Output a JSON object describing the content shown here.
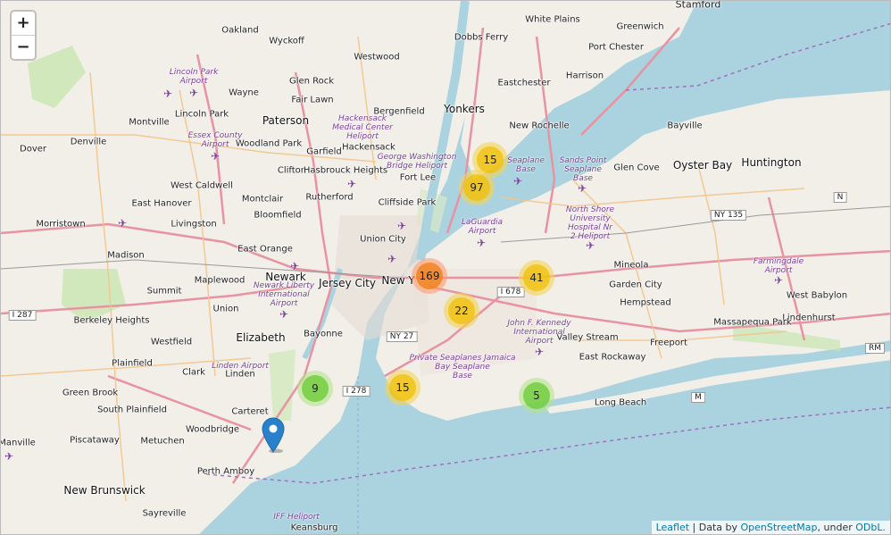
{
  "zoom": {
    "in_label": "+",
    "out_label": "−"
  },
  "clusters": [
    {
      "count": "15",
      "size": "medium"
    },
    {
      "count": "97",
      "size": "medium"
    },
    {
      "count": "169",
      "size": "large"
    },
    {
      "count": "41",
      "size": "medium"
    },
    {
      "count": "22",
      "size": "medium"
    },
    {
      "count": "9",
      "size": "small"
    },
    {
      "count": "15",
      "size": "medium"
    },
    {
      "count": "5",
      "size": "small"
    }
  ],
  "places": {
    "stamford": "Stamford",
    "oakland": "Oakland",
    "wyckoff": "Wyckoff",
    "dobbs_ferry": "Dobbs Ferry",
    "white_plains": "White Plains",
    "greenwich": "Greenwich",
    "westwood": "Westwood",
    "port_chester": "Port Chester",
    "glen_rock": "Glen Rock",
    "wayne": "Wayne",
    "fair_lawn": "Fair Lawn",
    "eastchester": "Eastchester",
    "harrison": "Harrison",
    "yonkers": "Yonkers",
    "bergenfield": "Bergenfield",
    "montville": "Montville",
    "lincoln_park": "Lincoln Park",
    "paterson": "Paterson",
    "new_rochelle": "New Rochelle",
    "bayville": "Bayville",
    "dover": "Dover",
    "denville": "Denville",
    "woodland_park": "Woodland Park",
    "garfield": "Garfield",
    "hackensack": "Hackensack",
    "clifton": "Clifton",
    "hasbrouck_heights": "Hasbrouck Heights",
    "oyster_bay": "Oyster Bay",
    "huntington": "Huntington",
    "glen_cove": "Glen Cove",
    "fort_lee": "Fort Lee",
    "west_caldwell": "West Caldwell",
    "rutherford": "Rutherford",
    "montclair": "Montclair",
    "cliffside_park": "Cliffside Park",
    "east_hanover": "East Hanover",
    "morristown": "Morristown",
    "livingston": "Livingston",
    "bloomfield": "Bloomfield",
    "union_city": "Union City",
    "east_orange": "East Orange",
    "madison": "Madison",
    "mineola": "Mineola",
    "newark": "Newark",
    "maplewood": "Maplewood",
    "jersey_city": "Jersey City",
    "new_york": "New Y",
    "garden_city": "Garden City",
    "summit": "Summit",
    "hempstead": "Hempstead",
    "west_babylon": "West Babylon",
    "union": "Union",
    "berkeley_heights": "Berkeley Heights",
    "bayonne": "Bayonne",
    "lindenhurst": "Lindenhurst",
    "massapequa_park": "Massapequa Park",
    "elizabeth": "Elizabeth",
    "westfield": "Westfield",
    "valley_stream": "Valley Stream",
    "freeport": "Freeport",
    "east_rockaway": "East Rockaway",
    "plainfield": "Plainfield",
    "clark": "Clark",
    "linden": "Linden",
    "green_brook": "Green Brook",
    "long_beach": "Long Beach",
    "south_plainfield": "South Plainfield",
    "carteret": "Carteret",
    "woodbridge": "Woodbridge",
    "manville": "Manville",
    "piscataway": "Piscataway",
    "metuchen": "Metuchen",
    "perth_amboy": "Perth Amboy",
    "new_brunswick": "New Brunswick",
    "sayreville": "Sayreville",
    "keansburg": "Keansburg"
  },
  "pois": {
    "lincoln_park_airport": "Lincoln Park\nAirport",
    "hackensack_heliport": "Hackensack\nMedical Center\nHeliport",
    "essex_airport": "Essex County\nAirport",
    "gw_heliport": "George Washington\nBridge Heliport",
    "seaplane_base_1": "Seaplane\nBase",
    "sands_point": "Sands Point\nSeaplane\nBase",
    "laguardia": "LaGuardia\nAirport",
    "north_shore": "North Shore\nUniversity\nHospital Nr\n2 Heliport",
    "farmingdale": "Farmingdale\nAirport",
    "newark_airport": "Newark Liberty\nInternational\nAirport",
    "jfk": "John F. Kennedy\nInternational\nAirport",
    "linden_airport": "Linden Airport",
    "private_seaplanes": "Private Seaplanes Jamaica\nBay Seaplane\nBase",
    "iff_heliport": "IFF Heliport"
  },
  "shields": {
    "i287": "I 287",
    "ny135": "NY 135",
    "i678": "I 678",
    "ny27": "NY 27",
    "i278": "I 278",
    "rm": "RM",
    "m": "M",
    "n": "N"
  },
  "attribution": {
    "leaflet": "Leaflet",
    "sep": " | Data by ",
    "osm": "OpenStreetMap",
    "mid": ", under ",
    "odbl": "ODbL."
  },
  "colors": {
    "water": "#aad3df",
    "land": "#f2efe9",
    "motorway": "#e892a2",
    "primary": "#fcd6a4",
    "park": "#c8e6b0"
  }
}
